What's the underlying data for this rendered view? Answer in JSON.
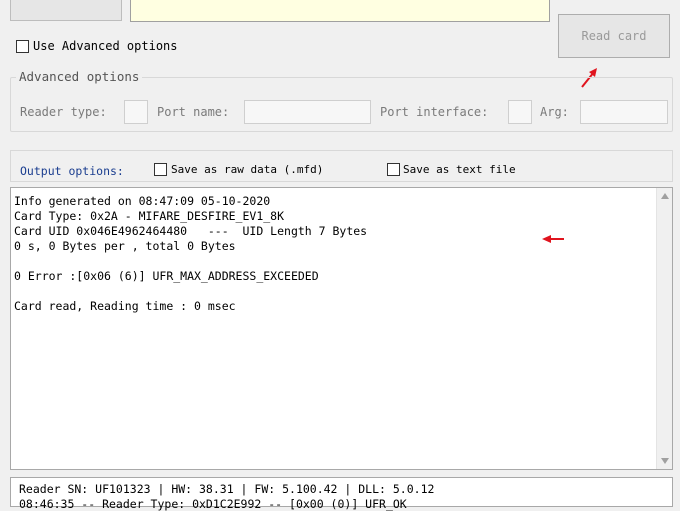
{
  "top": {
    "read_card_label": "Read card",
    "use_advanced_label": "Use Advanced options"
  },
  "advanced": {
    "title": "Advanced options",
    "reader_type_label": "Reader type:",
    "port_name_label": "Port name:",
    "port_interface_label": "Port interface:",
    "arg_label": "Arg:"
  },
  "output_options": {
    "label": "Output options:",
    "raw_label": "Save as raw data (.mfd)",
    "text_label": "Save as text file"
  },
  "output": {
    "lines": [
      "Info generated on 08:47:09 05-10-2020",
      "Card Type: 0x2A - MIFARE_DESFIRE_EV1_8K",
      "Card UID 0x046E4962464480   ---  UID Length 7 Bytes",
      "0 s, 0 Bytes per , total 0 Bytes",
      "0 Error :[0x06 (6)] UFR_MAX_ADDRESS_EXCEEDED",
      "Card read, Reading time : 0 msec"
    ]
  },
  "status": {
    "line1": "Reader SN: UF101323 | HW: 38.31 | FW: 5.100.42 | DLL: 5.0.12",
    "line2": "08:46:35 -- Reader Type: 0xD1C2E992 -- [0x00 (0)] UFR_OK"
  },
  "colors": {
    "arrow": "#e0141e",
    "input_bg": "#ffffe1",
    "output_label": "#1a3d8f"
  },
  "icons": [
    "checkbox-icon",
    "red-arrow-icon"
  ]
}
